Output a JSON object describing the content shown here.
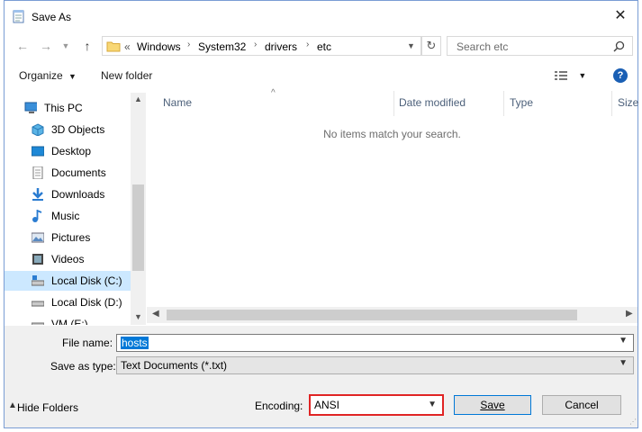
{
  "window": {
    "title": "Save As"
  },
  "address": {
    "overflow": "«",
    "segments": [
      "Windows",
      "System32",
      "drivers",
      "etc"
    ]
  },
  "search": {
    "placeholder": "Search etc"
  },
  "toolbar": {
    "organize": "Organize",
    "new_folder": "New folder"
  },
  "nav": {
    "items": [
      {
        "label": "This PC",
        "icon": "this-pc-icon"
      },
      {
        "label": "3D Objects",
        "icon": "3d-objects-icon"
      },
      {
        "label": "Desktop",
        "icon": "desktop-icon"
      },
      {
        "label": "Documents",
        "icon": "documents-icon"
      },
      {
        "label": "Downloads",
        "icon": "downloads-icon"
      },
      {
        "label": "Music",
        "icon": "music-icon"
      },
      {
        "label": "Pictures",
        "icon": "pictures-icon"
      },
      {
        "label": "Videos",
        "icon": "videos-icon"
      },
      {
        "label": "Local Disk (C:)",
        "icon": "local-disk-icon"
      },
      {
        "label": "Local Disk (D:)",
        "icon": "local-disk-icon"
      },
      {
        "label": "VM (E:)",
        "icon": "drive-icon"
      }
    ],
    "selected": "Local Disk (C:)"
  },
  "columns": [
    "Name",
    "Date modified",
    "Type",
    "Size"
  ],
  "empty_message": "No items match your search.",
  "form": {
    "file_name_label": "File name:",
    "file_name_value": "hosts",
    "save_as_type_label": "Save as type:",
    "save_as_type_value": "Text Documents (*.txt)",
    "encoding_label": "Encoding:",
    "encoding_value": "ANSI"
  },
  "buttons": {
    "save": "Save",
    "cancel": "Cancel",
    "hide_folders": "Hide Folders"
  },
  "colors": {
    "accent": "#0078d7",
    "highlight": "#e02424",
    "selected_bg": "#cce8ff"
  }
}
